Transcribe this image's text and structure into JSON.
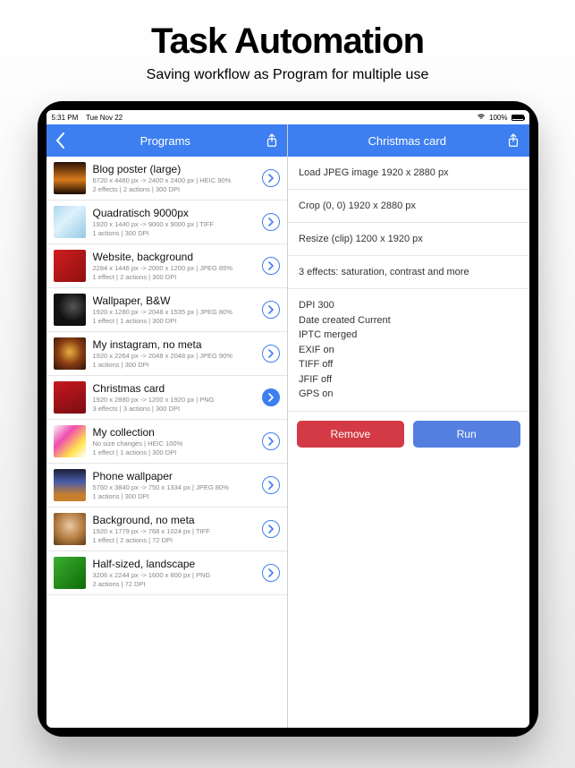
{
  "marketing": {
    "title": "Task Automation",
    "subtitle": "Saving workflow as Program for multiple use"
  },
  "statusbar": {
    "time": "5:31 PM",
    "date": "Tue Nov 22",
    "battery_pct": "100%"
  },
  "left": {
    "title": "Programs",
    "items": [
      {
        "title": "Blog poster (large)",
        "line1": "6720 x 4480 px -> 2400 x 2400 px | HEIC 90%",
        "line2": "2 effects | 2 actions | 300 DPI",
        "thumb": "sunset",
        "active": false
      },
      {
        "title": "Quadratisch 9000px",
        "line1": "1920 x 1440 px -> 9000 x 9000 px | TIFF",
        "line2": "1 actions | 300 DPI",
        "thumb": "ice",
        "active": false
      },
      {
        "title": "Website, background",
        "line1": "2284 x 1446 px -> 2000 x 1200 px | JPEG 85%",
        "line2": "1 effect | 2 actions | 300 DPI",
        "thumb": "red",
        "active": false
      },
      {
        "title": "Wallpaper, B&W",
        "line1": "1920 x 1280 px -> 2048 x 1535 px | JPEG 80%",
        "line2": "1 effect | 1 actions | 300 DPI",
        "thumb": "guitar",
        "active": false
      },
      {
        "title": "My instagram, no meta",
        "line1": "1920 x 2264 px -> 2048 x 2048 px | JPEG 90%",
        "line2": "1 actions | 300 DPI",
        "thumb": "burger",
        "active": false
      },
      {
        "title": "Christmas card",
        "line1": "1920 x 2880 px -> 1200 x 1920 px | PNG",
        "line2": "3 effects | 3 actions | 300 DPI",
        "thumb": "red2",
        "active": true
      },
      {
        "title": "My collection",
        "line1": "No size changes | HEIC 100%",
        "line2": "1 effect | 1 actions | 300 DPI",
        "thumb": "abstract",
        "active": false
      },
      {
        "title": "Phone wallpaper",
        "line1": "5760 x 3840 px -> 750 x 1334 px | JPEG 80%",
        "line2": "1 actions | 300 DPI",
        "thumb": "city",
        "active": false
      },
      {
        "title": "Background, no meta",
        "line1": "1920 x 1779 px -> 768 x 1024 px | TIFF",
        "line2": "1 effect | 2 actions | 72 DPI",
        "thumb": "puppy",
        "active": false
      },
      {
        "title": "Half-sized, landscape",
        "line1": "3206 x 2244 px -> 1600 x 800 px | PNG",
        "line2": "2 actions | 72 DPI",
        "thumb": "leaf",
        "active": false
      }
    ]
  },
  "right": {
    "title": "Christmas card",
    "steps": [
      "Load JPEG image 1920 x 2880 px",
      "Crop (0, 0) 1920 x 2880 px",
      "Resize (clip) 1200 x 1920 px",
      "3 effects: saturation, contrast and more"
    ],
    "meta_lines": [
      "DPI 300",
      "Date created Current",
      "IPTC merged",
      "EXIF on",
      "TIFF off",
      "JFIF off",
      "GPS on"
    ],
    "remove_label": "Remove",
    "run_label": "Run"
  },
  "thumb_styles": {
    "sunset": "linear-gradient(180deg,#2a1206 0%,#d97a1a 55%,#1a0b04 100%)",
    "ice": "linear-gradient(135deg,#aad6ef,#dff2fb 40%,#95c8e6)",
    "red": "linear-gradient(135deg,#d11e1e,#8f1010)",
    "guitar": "radial-gradient(circle at 60% 40%, #555 0%, #111 55%)",
    "burger": "radial-gradient(circle at 50% 45%, #e7b23c 0%, #8a3d14 50%, #2c1308 100%)",
    "red2": "linear-gradient(160deg,#c6181f,#7a0d12)",
    "abstract": "linear-gradient(135deg,#f7f7f7 0%,#f04db0 35%,#ffe14d 70%,#ffffff 100%)",
    "city": "linear-gradient(180deg,#1b1f3a 0%,#4a5ca8 40%,#c77f2d 80%)",
    "puppy": "radial-gradient(circle at 50% 40%, #e8c9a1 0%, #b37a3f 55%, #5a3b1b 100%)",
    "leaf": "linear-gradient(135deg,#3bae2e,#0e6b08)"
  }
}
